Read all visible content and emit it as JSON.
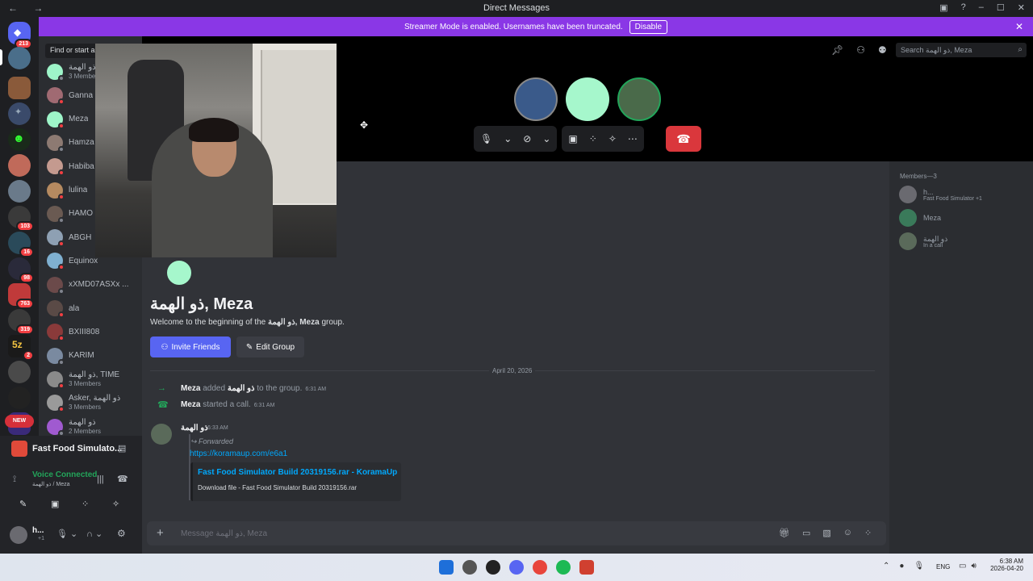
{
  "window": {
    "title": "Direct Messages"
  },
  "banner": {
    "text": "Streamer Mode is enabled. Usernames have been truncated.",
    "button": "Disable"
  },
  "rail": {
    "badges": {
      "home": "213",
      "s7": "103",
      "s8": "16",
      "s9": "98",
      "s10": "763",
      "s11": "319",
      "s12": "2"
    },
    "new_label": "NEW"
  },
  "dm_list": {
    "search_placeholder": "Find or start a conversation",
    "items": [
      {
        "name": "ذو الهمة",
        "sub": "3 Members",
        "color": "#9ef5c9"
      },
      {
        "name": "Ganna",
        "sub": "",
        "color": "#a06a72"
      },
      {
        "name": "Meza",
        "sub": "",
        "color": "#9ef5c9"
      },
      {
        "name": "Hamza",
        "sub": "",
        "color": "#8d7a72"
      },
      {
        "name": "Habiba",
        "sub": "",
        "color": "#c49a8f"
      },
      {
        "name": "lulina",
        "sub": "",
        "color": "#b58a60"
      },
      {
        "name": "HAMO",
        "sub": "",
        "color": "#6a5a52"
      },
      {
        "name": "ABGH",
        "sub": "",
        "color": "#8ea0b3"
      },
      {
        "name": "Equinox",
        "sub": "",
        "color": "#7fb0d0"
      },
      {
        "name": "xXMD07ASXx ...",
        "sub": "",
        "color": "#6b4a4a"
      },
      {
        "name": "ala",
        "sub": "",
        "color": "#5a4a46"
      },
      {
        "name": "BXIII808",
        "sub": "",
        "color": "#8a3a3a"
      },
      {
        "name": "KARIM",
        "sub": "",
        "color": "#7a8aa0"
      },
      {
        "name": "ذو الهمة, TIME",
        "sub": "3 Members",
        "color": "#8a8a8a"
      },
      {
        "name": "Asker, ذو الهمة",
        "sub": "3 Members",
        "color": "#9a9a9a"
      },
      {
        "name": "ذو الهمة",
        "sub": "2 Members",
        "color": "#a05ad0"
      }
    ]
  },
  "activity": {
    "game": "Fast Food Simulato..."
  },
  "voice": {
    "status": "Voice Connected",
    "channel": "ذو الهمة / Meza"
  },
  "user": {
    "name": "h...",
    "tag": "+1"
  },
  "header": {
    "search_placeholder": "Search ذو الهمة, Meza"
  },
  "intro": {
    "title": "ذو الهمة, Meza",
    "welcome_prefix": "Welcome to the beginning of the ",
    "welcome_name": "ذو الهمة, Meza",
    "welcome_suffix": " group.",
    "invite": "Invite Friends",
    "edit": "Edit Group"
  },
  "divider_date": "April 20, 2026",
  "system": [
    {
      "actor": "Meza",
      "text": " added ",
      "target": "ذو الهمة",
      "tail": " to the group.",
      "time": "6:31 AM"
    },
    {
      "actor": "Meza",
      "text": " started a call.",
      "target": "",
      "tail": "",
      "time": "6:31 AM"
    }
  ],
  "message": {
    "author": "ذو الهمة",
    "time": "6:33 AM",
    "forwarded": "Forwarded",
    "link": "https://koramaup.com/e6a1",
    "embed_title": "Fast Food Simulator Build 20319156.rar - KoramaUp",
    "embed_desc": "Download file - Fast Food Simulator Build 20319156.rar"
  },
  "composer": {
    "placeholder": "Message ذو الهمة, Meza"
  },
  "members": {
    "header": "Members—3",
    "list": [
      {
        "name": "h...",
        "status": "Fast Food Simulator +1"
      },
      {
        "name": "Meza",
        "status": ""
      },
      {
        "name": "ذو الهمة",
        "status": "In a call"
      }
    ]
  },
  "taskbar": {
    "lang": "ENG",
    "time": "6:38 AM",
    "date": "2026-04-20"
  }
}
